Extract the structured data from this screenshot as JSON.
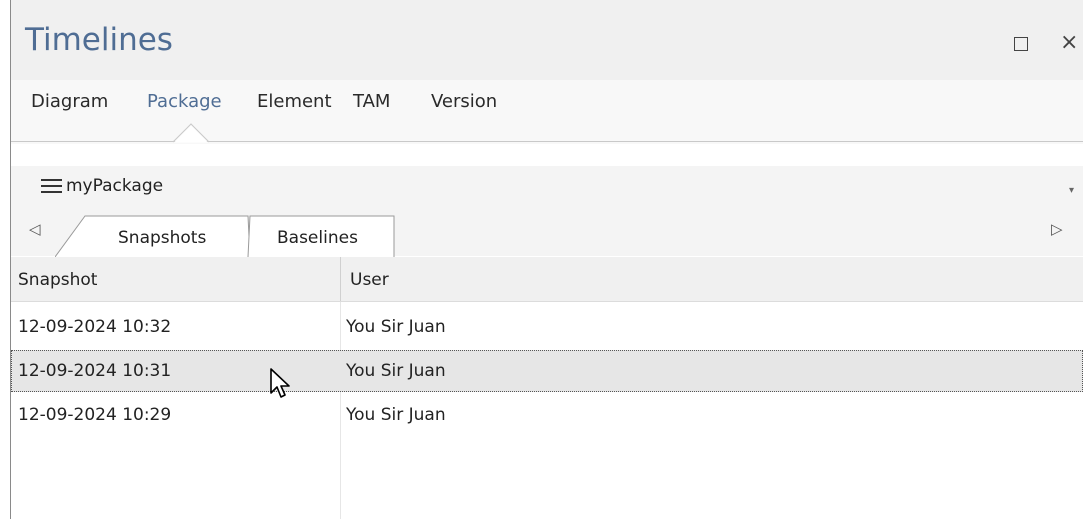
{
  "window": {
    "title": "Timelines",
    "maximize_icon": "maximize-icon",
    "close_icon": "close-icon",
    "close_glyph": "×"
  },
  "mode_tabs": [
    {
      "label": "Diagram",
      "active": false
    },
    {
      "label": "Package",
      "active": true
    },
    {
      "label": "Element",
      "active": false
    },
    {
      "label": "TAM",
      "active": false
    },
    {
      "label": "Version",
      "active": false
    }
  ],
  "package_selector": {
    "icon": "menu-icon",
    "label": "myPackage",
    "dropdown_icon": "dropdown-arrow-icon",
    "dropdown_glyph": "▾"
  },
  "sub_tabs": {
    "scroll_left_glyph": "◁",
    "scroll_right_glyph": "▷",
    "items": [
      {
        "label": "Snapshots",
        "active": true
      },
      {
        "label": "Baselines",
        "active": false
      }
    ]
  },
  "grid": {
    "columns": [
      "Snapshot",
      "User"
    ],
    "rows": [
      {
        "snapshot": "12-09-2024 10:32",
        "user": "You Sir Juan",
        "selected": false
      },
      {
        "snapshot": "12-09-2024 10:31",
        "user": "You Sir Juan",
        "selected": true
      },
      {
        "snapshot": "12-09-2024 10:29",
        "user": "You Sir Juan",
        "selected": false
      }
    ]
  },
  "colors": {
    "title": "#4f6d94",
    "active_tab": "#4f6d94",
    "selection": "#e6e6e6"
  }
}
